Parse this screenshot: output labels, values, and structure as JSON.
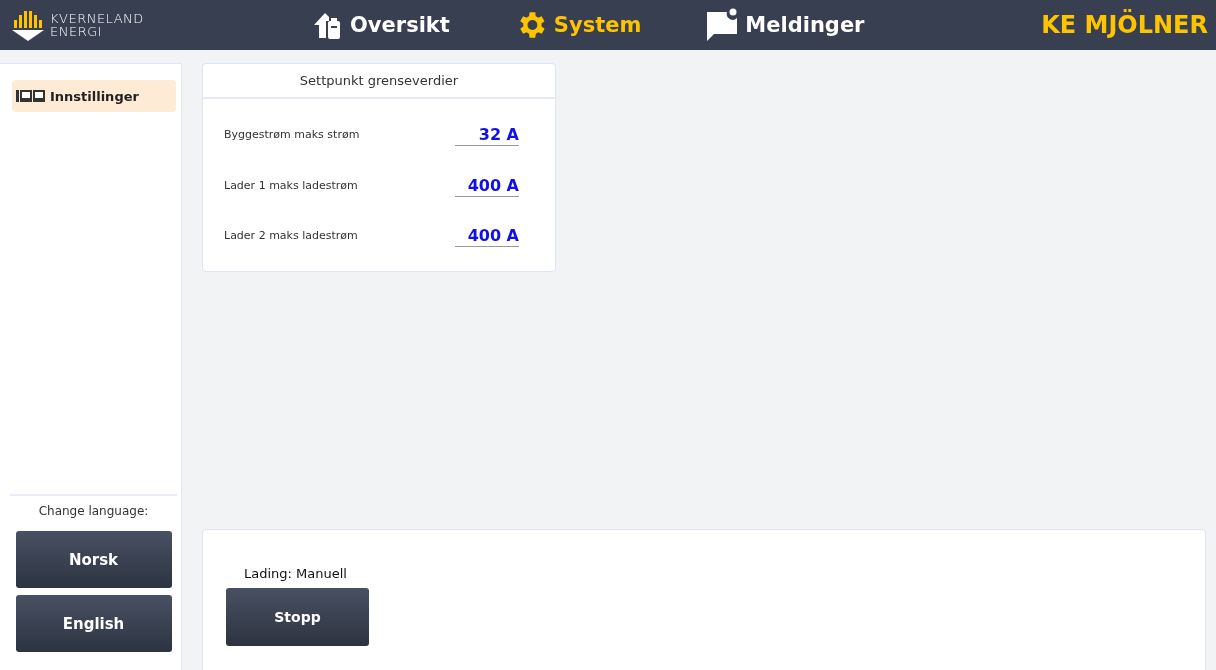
{
  "header": {
    "logo": [
      "KVERNELAND",
      "ENERGI"
    ],
    "nav": [
      {
        "label": "Oversikt",
        "selected": false
      },
      {
        "label": "System",
        "selected": true
      },
      {
        "label": "Meldinger",
        "selected": false
      }
    ],
    "title": "KE MJÖLNER"
  },
  "sidebar": {
    "items": [
      {
        "label": "Innstillinger",
        "selected": true
      }
    ],
    "language_label": "Change language:",
    "language_buttons": [
      "Norsk",
      "English"
    ]
  },
  "limits_card": {
    "title": "Settpunkt grenseverdier",
    "rows": [
      {
        "label": "Byggestrøm maks strøm",
        "value": "32 A"
      },
      {
        "label": "Lader 1 maks ladestrøm",
        "value": "400 A"
      },
      {
        "label": "Lader 2 maks ladestrøm",
        "value": "400 A"
      }
    ]
  },
  "charging_panel": {
    "status": "Lading: Manuell",
    "button": "Stopp"
  }
}
